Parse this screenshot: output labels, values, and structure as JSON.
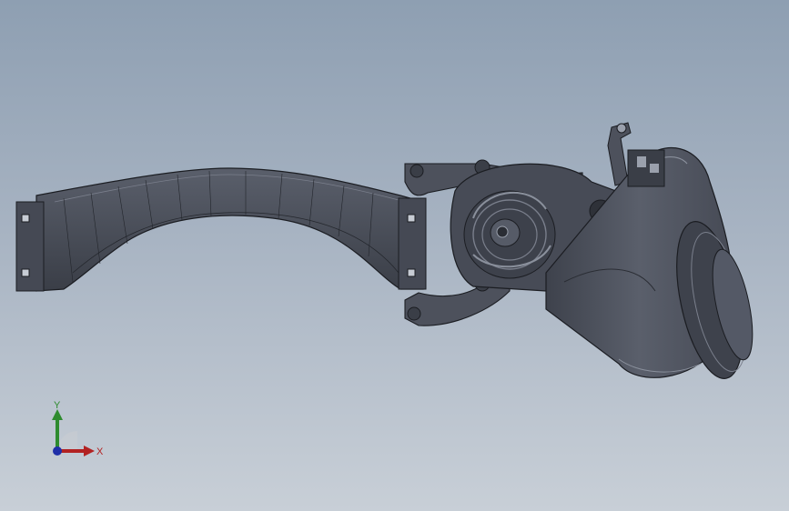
{
  "viewport": {
    "background_top": "#8e9fb2",
    "background_bottom": "#c8cfd7"
  },
  "model": {
    "part_color": "#4a4e58",
    "edge_color": "#1b1d22",
    "highlight_color": "#6a6f7c"
  },
  "triad": {
    "x_label": "X",
    "y_label": "Y",
    "x_color": "#b22222",
    "y_color": "#2e8b2e",
    "z_color": "#1f2fa8"
  }
}
